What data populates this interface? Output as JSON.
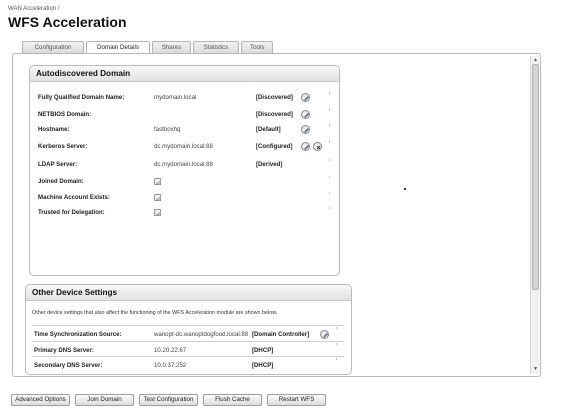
{
  "breadcrumb": "WAN Acceleration /",
  "title": "WFS Acceleration",
  "tabs": [
    {
      "label": "Configuration"
    },
    {
      "label": "Domain Details"
    },
    {
      "label": "Shares"
    },
    {
      "label": "Statistics"
    },
    {
      "label": "Tools"
    }
  ],
  "autodiscovered": {
    "title": "Autodiscovered Domain",
    "rows": [
      {
        "label": "Fully Qualified Domain Name:",
        "value": "mydomain.local",
        "status": "[Discovered]",
        "edit": true,
        "delete": false,
        "checkbox": false
      },
      {
        "label": "NETBIOS Domain:",
        "value": "",
        "status": "[Discovered]",
        "edit": true,
        "delete": false,
        "checkbox": false
      },
      {
        "label": "Hostname:",
        "value": "fastboxhq",
        "status": "[Default]",
        "edit": true,
        "delete": false,
        "checkbox": false
      },
      {
        "label": "Kerberos Server:",
        "value": "dc.mydomain.local:88",
        "status": "[Configured]",
        "edit": true,
        "delete": true,
        "checkbox": false
      },
      {
        "label": "LDAP Server:",
        "value": "dc.mydomain.local:88",
        "status": "[Derived]",
        "edit": false,
        "delete": false,
        "checkbox": false
      },
      {
        "label": "Joined Domain:",
        "value": "",
        "status": "",
        "edit": false,
        "delete": false,
        "checkbox": true
      },
      {
        "label": "Machine Account Exists:",
        "value": "",
        "status": "",
        "edit": false,
        "delete": false,
        "checkbox": true
      },
      {
        "label": "Trusted for Delegation:",
        "value": "",
        "status": "",
        "edit": false,
        "delete": false,
        "checkbox": true
      }
    ]
  },
  "other_settings": {
    "title": "Other Device Settings",
    "note": "Other device settings that also affect the functioning of the WFS Acceleration module are shown below.",
    "rows": [
      {
        "label": "Time Synchronization Source:",
        "value": "wanopt-dc.wanoptdogfood.local:88",
        "status": "[Domain Controller]",
        "edit": true
      },
      {
        "label": "Primary DNS Server:",
        "value": "10.20.22.67",
        "status": "[DHCP]",
        "edit": false
      },
      {
        "label": "Secondary DNS Server:",
        "value": "10.0.37.252",
        "status": "[DHCP]",
        "edit": false
      }
    ]
  },
  "footer_buttons": [
    {
      "label": "Advanced Options"
    },
    {
      "label": "Join Domain"
    },
    {
      "label": "Test Configuration"
    },
    {
      "label": "Flush Cache"
    },
    {
      "label": "Restart WFS"
    }
  ],
  "icons": {
    "edit": "pencil-icon",
    "delete": "close-icon",
    "checkbox": "checkmark-icon"
  },
  "colors": {
    "panel_border": "#b8b8b8",
    "header_bg": "#e8e8e8",
    "checkbox_check": "#9a9a9a"
  }
}
